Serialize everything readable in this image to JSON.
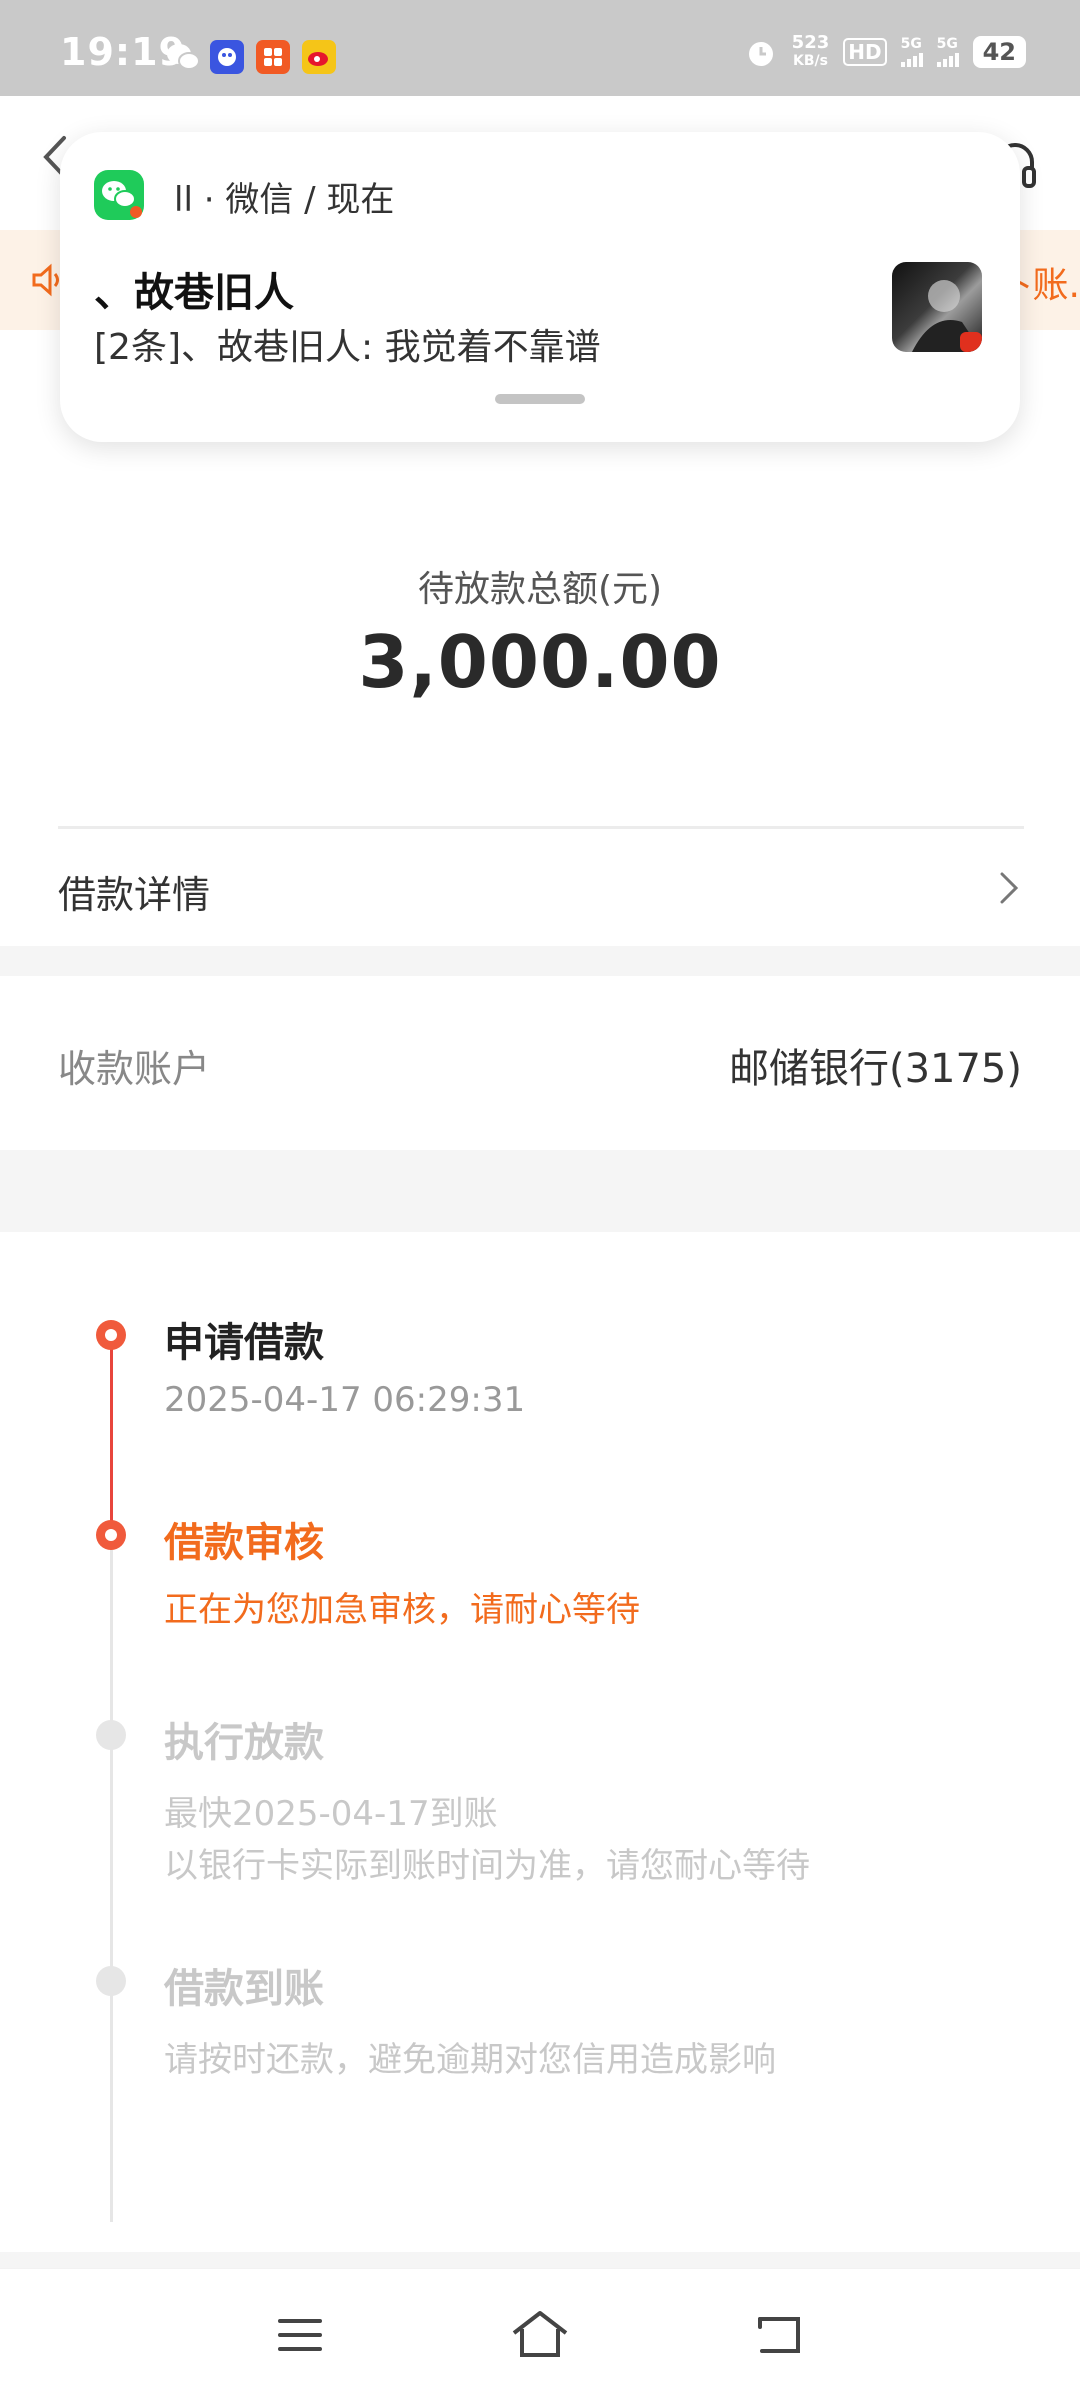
{
  "status_bar": {
    "time": "19:19",
    "net_speed_value": "523",
    "net_speed_unit": "KB/s",
    "hd_label": "HD",
    "sim1_label": "5G",
    "sim2_label": "5G",
    "battery": "42"
  },
  "notification": {
    "source": "ll · 微信 / 现在",
    "title": "、故巷旧人",
    "message": "[2条]、故巷旧人: 我觉着不靠谱"
  },
  "notice": {
    "text": "卜账."
  },
  "amount": {
    "label": "待放款总额(元)",
    "value": "3,000.00"
  },
  "loan_detail": {
    "label": "借款详情"
  },
  "account": {
    "label": "收款账户",
    "value": "邮储银行(3175)"
  },
  "timeline": [
    {
      "title": "申请借款",
      "subtitle": "2025-04-17 06:29:31",
      "state": "done"
    },
    {
      "title": "借款审核",
      "subtitle": "正在为您加急审核，请耐心等待",
      "state": "current"
    },
    {
      "title": "执行放款",
      "subtitle_lines": [
        "最快2025-04-17到账",
        "以银行卡实际到账时间为准，请您耐心等待"
      ],
      "state": "pending"
    },
    {
      "title": "借款到账",
      "subtitle": "请按时还款，避免逾期对您信用造成影响",
      "state": "pending"
    }
  ],
  "colors": {
    "accent": "#f26b1d",
    "timeline_done": "#f05a3c",
    "pending": "#c8c8c8"
  },
  "icons": [
    "back-icon",
    "headset-icon",
    "speaker-icon",
    "wechat-icon",
    "chevron-right-icon",
    "menu-icon",
    "home-icon",
    "back-nav-icon"
  ]
}
